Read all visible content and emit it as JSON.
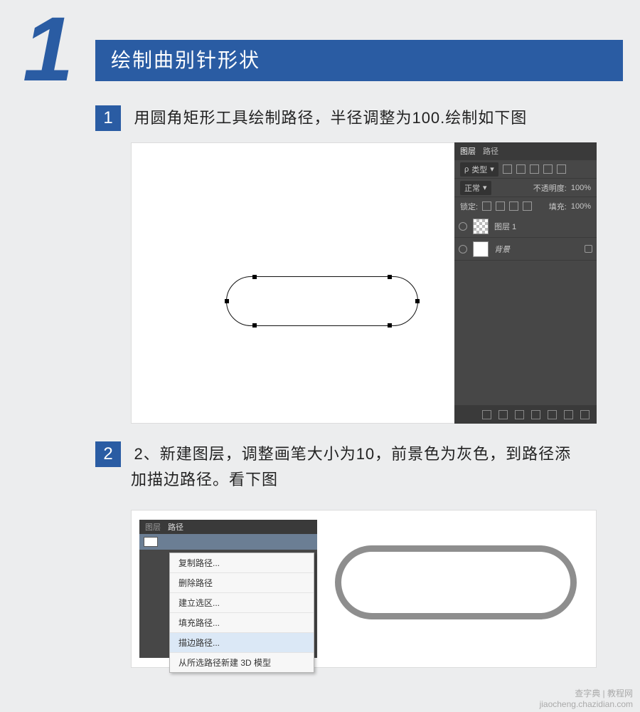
{
  "section": {
    "number": "1",
    "title": "绘制曲别针形状"
  },
  "steps": {
    "s1": {
      "num": "1",
      "text": "用圆角矩形工具绘制路径，半径调整为100.绘制如下图"
    },
    "s2": {
      "num": "2",
      "line1": "2、新建图层，调整画笔大小为10，前景色为灰色，到路径添",
      "line2": "加描边路径。看下图"
    }
  },
  "layers_panel": {
    "tab_layers": "图层",
    "tab_paths": "路径",
    "filter_label": "类型",
    "blend_mode": "正常",
    "opacity_label": "不透明度:",
    "opacity_value": "100%",
    "lock_label": "锁定:",
    "fill_label": "填充:",
    "fill_value": "100%",
    "layer1_name": "图层 1",
    "bg_name": "背景"
  },
  "paths_panel": {
    "tab_layers": "图层",
    "tab_paths": "路径"
  },
  "context_menu": {
    "m1": "复制路径...",
    "m2": "删除路径",
    "m3": "建立选区...",
    "m4": "填充路径...",
    "m5": "描边路径...",
    "m6": "从所选路径新建 3D 模型"
  },
  "watermark": {
    "line1": "查字典 | 教程网",
    "line2": "jiaocheng.chazidian.com"
  }
}
